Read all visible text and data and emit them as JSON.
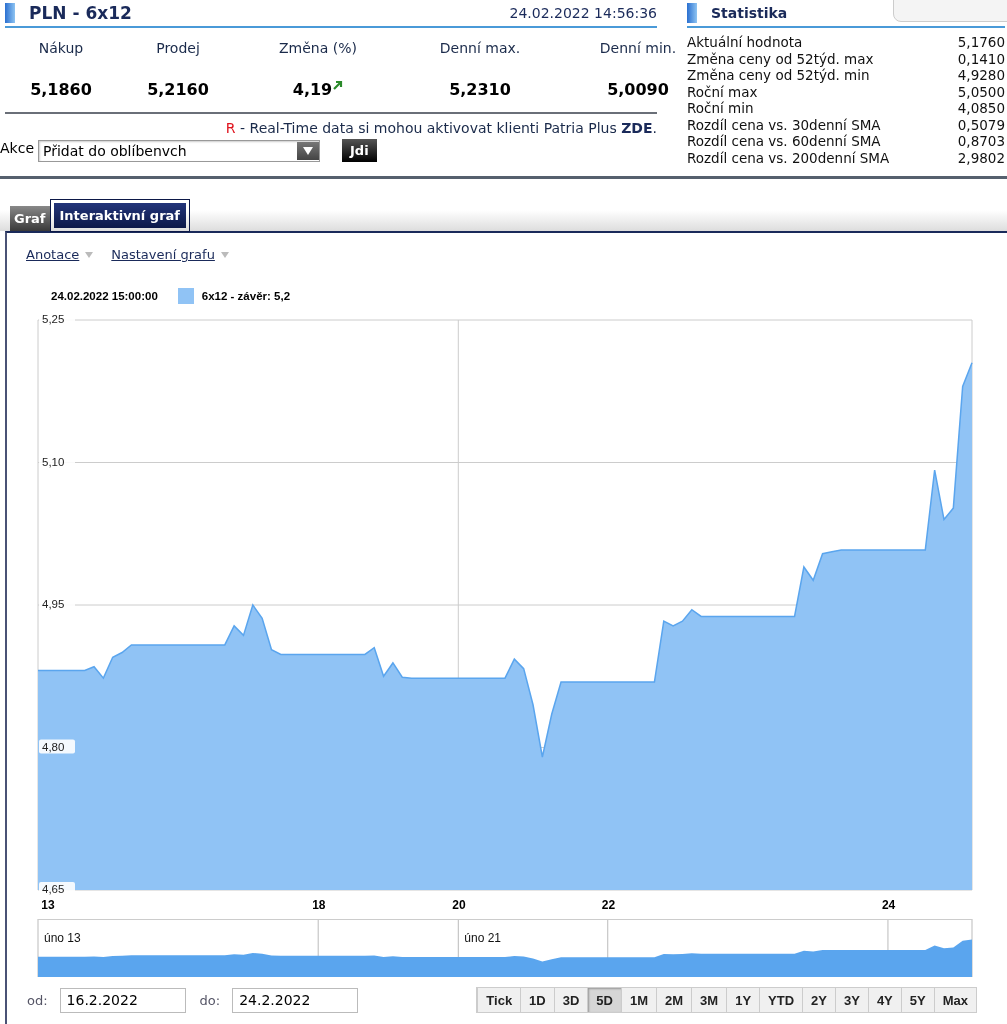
{
  "quote": {
    "title": "PLN - 6x12",
    "timestamp": "24.02.2022 14:56:36",
    "columns": [
      {
        "label": "Nákup",
        "value": "5,1860"
      },
      {
        "label": "Prodej",
        "value": "5,2160"
      },
      {
        "label": "Změna (%)",
        "value": "4,19",
        "rising": true
      },
      {
        "label": "Denní max.",
        "value": "5,2310"
      },
      {
        "label": "Denní min.",
        "value": "5,0090"
      }
    ],
    "notice": {
      "mark": "R",
      "text": " - Real-Time data si mohou aktivovat klienti Patria Plus ",
      "link": "ZDE",
      "end": "."
    },
    "action": {
      "label": "Akce",
      "value": "Přidat do oblíbenvch",
      "button": "Jdi"
    }
  },
  "statistics": {
    "title": "Statistika",
    "rows": [
      {
        "label": "Aktuální hodnota",
        "value": "5,1760"
      },
      {
        "label": "Změna ceny od 52týd. max",
        "value": "0,1410"
      },
      {
        "label": "Změna ceny od 52týd. min",
        "value": "4,9280"
      },
      {
        "label": "Roční max",
        "value": "5,0500"
      },
      {
        "label": "Roční min",
        "value": "4,0850"
      },
      {
        "label": "Rozdíl cena vs. 30denní SMA",
        "value": "0,5079"
      },
      {
        "label": "Rozdíl cena vs. 60denní SMA",
        "value": "0,8703"
      },
      {
        "label": "Rozdíl cena vs. 200denní SMA",
        "value": "2,9802"
      }
    ]
  },
  "tabs": [
    {
      "label": "Graf",
      "selected": false
    },
    {
      "label": "Interaktivní graf",
      "selected": true
    }
  ],
  "chart_menu": [
    "Anotace",
    "Nastavení grafu"
  ],
  "tooltip": {
    "time": "24.02.2022 15:00:00",
    "series": " - závěr: 5,2"
  },
  "chart_data": {
    "type": "area",
    "grid": true,
    "ylim": [
      4.65,
      5.25
    ],
    "categories": [
      null,
      "13",
      null,
      null,
      null,
      null,
      null,
      null,
      null,
      null,
      null,
      null,
      null,
      null,
      null,
      null,
      null,
      null,
      null,
      null,
      null,
      null,
      null,
      null,
      null,
      null,
      null,
      null,
      null,
      null,
      "18",
      null,
      null,
      null,
      null,
      null,
      null,
      null,
      null,
      null,
      null,
      null,
      null,
      null,
      null,
      "20",
      null,
      null,
      null,
      null,
      null,
      null,
      null,
      null,
      null,
      null,
      null,
      null,
      null,
      null,
      null,
      "22",
      null,
      null,
      null,
      null,
      null,
      null,
      null,
      null,
      null,
      null,
      null,
      null,
      null,
      null,
      null,
      null,
      null,
      null,
      null,
      null,
      null,
      null,
      null,
      null,
      null,
      null,
      null,
      null,
      null,
      "24",
      null,
      null,
      null,
      null,
      null,
      null,
      null,
      null,
      null
    ],
    "yticks": [
      {
        "value": 4.65,
        "label": "4,65"
      },
      {
        "value": 4.8,
        "label": "4,80"
      },
      {
        "value": 4.95,
        "label": "4,95"
      },
      {
        "value": 5.1,
        "label": "5,10"
      },
      {
        "value": 5.25,
        "label": "5,25"
      }
    ],
    "series": [
      {
        "name": "6x12",
        "color": "#90c3f5",
        "values": [
          4.881,
          4.881,
          4.881,
          4.881,
          4.881,
          4.881,
          4.885,
          4.873,
          4.895,
          4.9,
          4.908,
          4.908,
          4.908,
          4.908,
          4.908,
          4.908,
          4.908,
          4.908,
          4.908,
          4.908,
          4.908,
          4.928,
          4.918,
          4.95,
          4.936,
          4.903,
          4.898,
          4.898,
          4.898,
          4.898,
          4.898,
          4.898,
          4.898,
          4.898,
          4.898,
          4.898,
          4.905,
          4.875,
          4.889,
          4.874,
          4.873,
          4.873,
          4.873,
          4.873,
          4.873,
          4.873,
          4.873,
          4.873,
          4.873,
          4.873,
          4.873,
          4.893,
          4.883,
          4.845,
          4.79,
          4.835,
          4.869,
          4.869,
          4.869,
          4.869,
          4.869,
          4.869,
          4.869,
          4.869,
          4.869,
          4.869,
          4.869,
          4.933,
          4.928,
          4.933,
          4.945,
          4.938,
          4.938,
          4.938,
          4.938,
          4.938,
          4.938,
          4.938,
          4.938,
          4.938,
          4.938,
          4.938,
          4.99,
          4.976,
          5.004,
          5.006,
          5.008,
          5.008,
          5.008,
          5.008,
          5.008,
          5.008,
          5.008,
          5.008,
          5.008,
          5.008,
          5.092,
          5.04,
          5.052,
          5.18,
          5.205
        ]
      }
    ]
  },
  "navigator": {
    "labels": [
      "úno 13",
      "úno 21"
    ]
  },
  "range": {
    "from_label": "od:",
    "from": "16.2.2022",
    "to_label": "do:",
    "to": "24.2.2022",
    "buttons": [
      {
        "label": "Tick",
        "selected": false
      },
      {
        "label": "1D",
        "selected": false
      },
      {
        "label": "3D",
        "selected": false
      },
      {
        "label": "5D",
        "selected": true
      },
      {
        "label": "1M",
        "selected": false
      },
      {
        "label": "2M",
        "selected": false
      },
      {
        "label": "3M",
        "selected": false
      },
      {
        "label": "1Y",
        "selected": false
      },
      {
        "label": "YTD",
        "selected": false
      },
      {
        "label": "2Y",
        "selected": false
      },
      {
        "label": "3Y",
        "selected": false
      },
      {
        "label": "4Y",
        "selected": false
      },
      {
        "label": "5Y",
        "selected": false
      },
      {
        "label": "Max",
        "selected": false
      }
    ]
  }
}
